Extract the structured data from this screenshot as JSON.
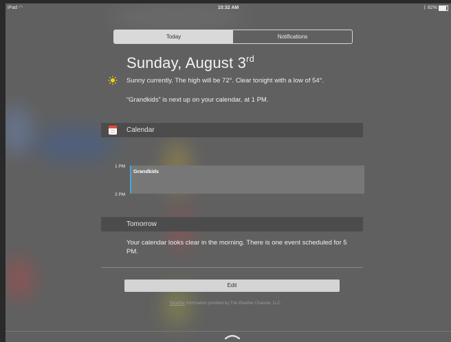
{
  "status_bar": {
    "device": "iPad",
    "time": "10:32 AM",
    "battery": "82%"
  },
  "tabs": [
    {
      "label": "Today",
      "active": true
    },
    {
      "label": "Notifications",
      "active": false
    }
  ],
  "today": {
    "date": "Sunday, August 3",
    "date_suffix": "rd",
    "weather_summary": "Sunny currently. The high will be 72°. Clear tonight with a low of 54°.",
    "next_event": "“Grandkids” is next up on your calendar, at 1 PM."
  },
  "calendar": {
    "title": "Calendar",
    "times": [
      "1 PM",
      "2 PM"
    ],
    "event": "Grandkids"
  },
  "tomorrow": {
    "title": "Tomorrow",
    "text": "Your calendar looks clear in the morning. There is one event scheduled for 5 PM."
  },
  "edit_label": "Edit",
  "footer": {
    "link": "Weather",
    "text": " information provided by The Weather Channel, LLC."
  },
  "icons": [
    "wifi-icon",
    "bluetooth-icon",
    "battery-icon",
    "sun-icon",
    "calendar-icon",
    "chevron-up-icon"
  ],
  "colors": {
    "accent_event": "#4aa3df",
    "sun": "#f5d20a",
    "calendar_red": "#e74c3c"
  }
}
